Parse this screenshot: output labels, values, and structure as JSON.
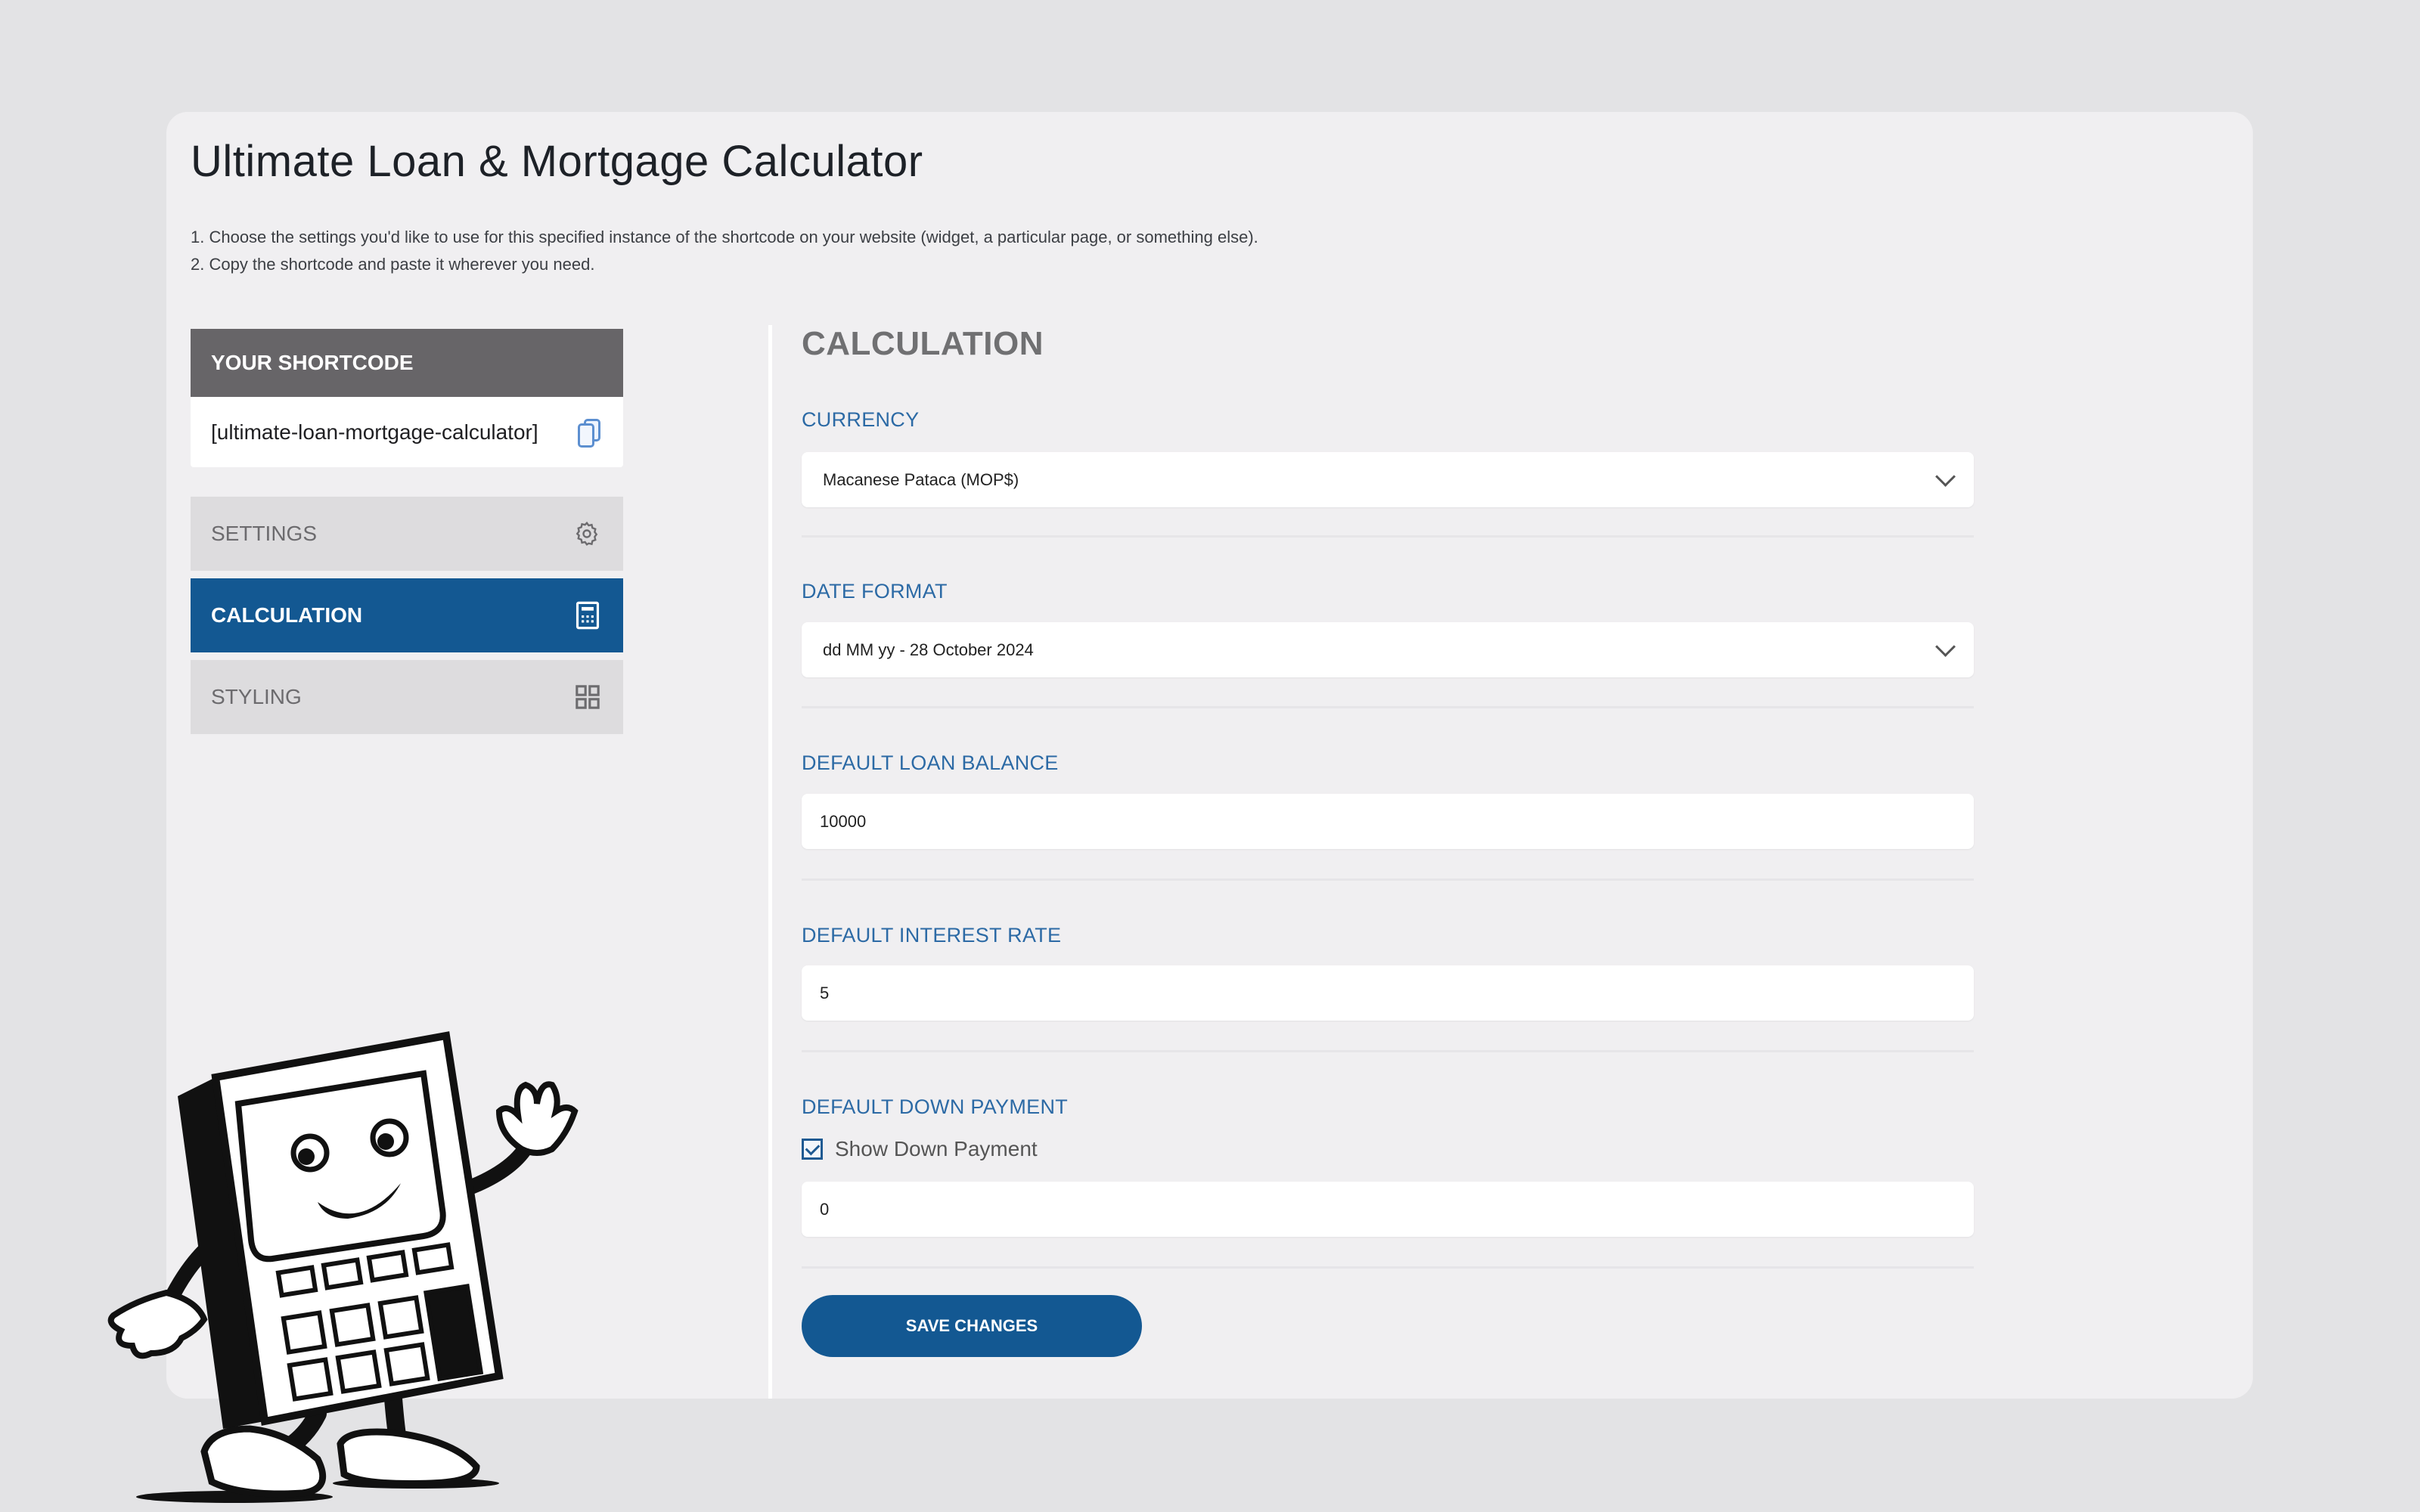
{
  "page": {
    "title": "Ultimate Loan & Mortgage Calculator",
    "instructions": [
      "1. Choose the settings you'd like to use for this specified instance of the shortcode on your website (widget, a particular page, or something else).",
      "2. Copy the shortcode and paste it wherever you need."
    ]
  },
  "sidebar": {
    "shortcode_header": "YOUR SHORTCODE",
    "shortcode_value": "[ultimate-loan-mortgage-calculator]",
    "copy_icon": "copy-icon",
    "items": [
      {
        "label": "SETTINGS",
        "icon": "gear-icon",
        "active": false
      },
      {
        "label": "CALCULATION",
        "icon": "calculator-icon",
        "active": true
      },
      {
        "label": "STYLING",
        "icon": "grid-icon",
        "active": false
      }
    ]
  },
  "content": {
    "section_title": "CALCULATION",
    "currency": {
      "label": "CURRENCY",
      "value": "Macanese Pataca (MOP$)"
    },
    "date_format": {
      "label": "DATE FORMAT",
      "value": "dd MM yy - 28 October 2024"
    },
    "loan_balance": {
      "label": "DEFAULT LOAN BALANCE",
      "value": "10000"
    },
    "interest_rate": {
      "label": "DEFAULT INTEREST RATE",
      "value": "5"
    },
    "down_payment": {
      "label": "DEFAULT DOWN PAYMENT",
      "checkbox_label": "Show Down Payment",
      "checked": true,
      "value": "0"
    },
    "save_label": "SAVE CHANGES"
  },
  "colors": {
    "accent": "#135892",
    "label_blue": "#2c6aa5",
    "shortcode_header_bg": "#676568",
    "inactive_nav_bg": "#dddcde"
  }
}
